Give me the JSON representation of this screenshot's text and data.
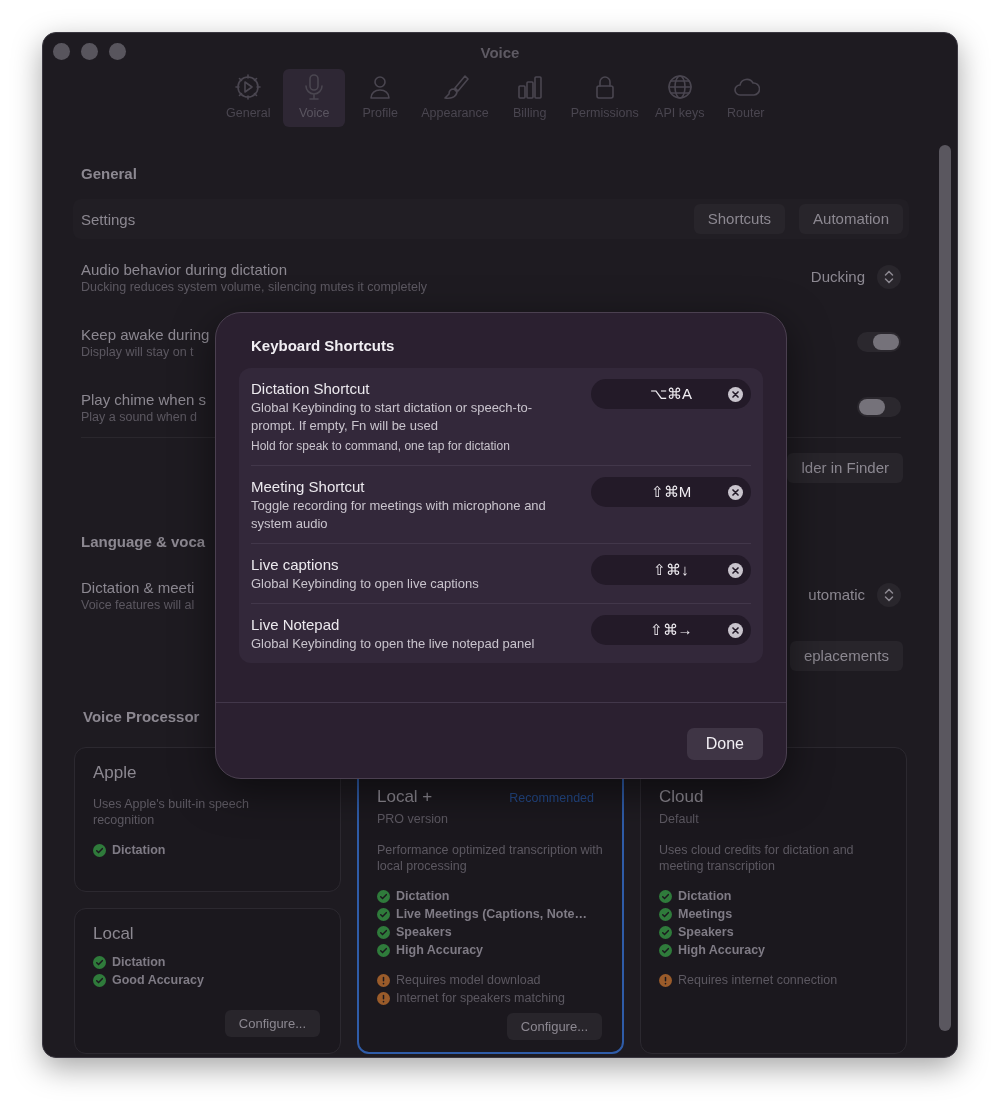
{
  "window": {
    "title": "Voice"
  },
  "tabs": [
    {
      "label": "General",
      "selected": false
    },
    {
      "label": "Voice",
      "selected": true
    },
    {
      "label": "Profile",
      "selected": false
    },
    {
      "label": "Appearance",
      "selected": false
    },
    {
      "label": "Billing",
      "selected": false
    },
    {
      "label": "Permissions",
      "selected": false
    },
    {
      "label": "API keys",
      "selected": false
    },
    {
      "label": "Router",
      "selected": false
    }
  ],
  "general": {
    "heading": "General",
    "settings_label": "Settings",
    "settings_buttons": [
      "Shortcuts",
      "Automation"
    ],
    "rows": [
      {
        "kind": "select",
        "title": "Audio behavior during dictation",
        "subtitle": "Ducking reduces system volume, silencing mutes it completely",
        "value": "Ducking"
      },
      {
        "kind": "toggle",
        "title": "Keep awake during",
        "subtitle": "Display will stay on t",
        "on": true
      },
      {
        "kind": "toggle",
        "title": "Play chime when s",
        "subtitle": "Play a sound when d",
        "on": false
      },
      {
        "kind": "button",
        "label": "lder in Finder"
      }
    ]
  },
  "language": {
    "heading": "Language & voca",
    "rows": [
      {
        "kind": "select",
        "title": "Dictation & meeti",
        "subtitle": "Voice features will al",
        "value": "utomatic"
      },
      {
        "kind": "button",
        "label": "eplacements"
      }
    ]
  },
  "voice_processor": {
    "heading": "Voice Processor",
    "cards": [
      {
        "title": "Apple",
        "description": "Uses Apple's built-in speech recognition",
        "selected": false,
        "features": [
          {
            "kind": "check",
            "text": "Dictation"
          }
        ]
      },
      {
        "title": "Local",
        "selected": false,
        "features": [
          {
            "kind": "check",
            "text": "Dictation"
          },
          {
            "kind": "check",
            "text": "Good Accuracy"
          }
        ],
        "button": "Configure..."
      },
      {
        "title": "Local +",
        "badge": "Recommended",
        "subtitle": "PRO version",
        "description": "Performance optimized transcription with local processing",
        "selected": true,
        "features": [
          {
            "kind": "check",
            "text": "Dictation"
          },
          {
            "kind": "check",
            "text": "Live Meetings (Captions, Note…"
          },
          {
            "kind": "check",
            "text": "Speakers"
          },
          {
            "kind": "check",
            "text": "High Accuracy"
          },
          {
            "kind": "warning",
            "text": "Requires model download"
          },
          {
            "kind": "warning",
            "text": "Internet for speakers matching"
          }
        ],
        "button": "Configure..."
      },
      {
        "title": "Cloud",
        "subtitle": "Default",
        "description": "Uses cloud credits for dictation and meeting transcription",
        "selected": false,
        "features": [
          {
            "kind": "check",
            "text": "Dictation"
          },
          {
            "kind": "check",
            "text": "Meetings"
          },
          {
            "kind": "check",
            "text": "Speakers"
          },
          {
            "kind": "check",
            "text": "High Accuracy"
          },
          {
            "kind": "warning",
            "text": "Requires internet connection"
          }
        ]
      }
    ]
  },
  "dialog": {
    "title": "Keyboard Shortcuts",
    "shortcuts": [
      {
        "title": "Dictation Shortcut",
        "description": "Global Keybinding to start dictation or speech-to-prompt. If empty, Fn will be used",
        "hint": "Hold for speak to command, one tap for dictation",
        "keys": "⌥⌘A"
      },
      {
        "title": "Meeting Shortcut",
        "description": "Toggle recording for meetings with microphone and system audio",
        "keys": "⇧⌘M"
      },
      {
        "title": "Live captions",
        "description": "Global Keybinding to open live captions",
        "keys": "⇧⌘↓"
      },
      {
        "title": "Live Notepad",
        "description": "Global Keybinding to open the live notepad panel",
        "keys": "⇧⌘→"
      }
    ],
    "done_button": "Done"
  }
}
